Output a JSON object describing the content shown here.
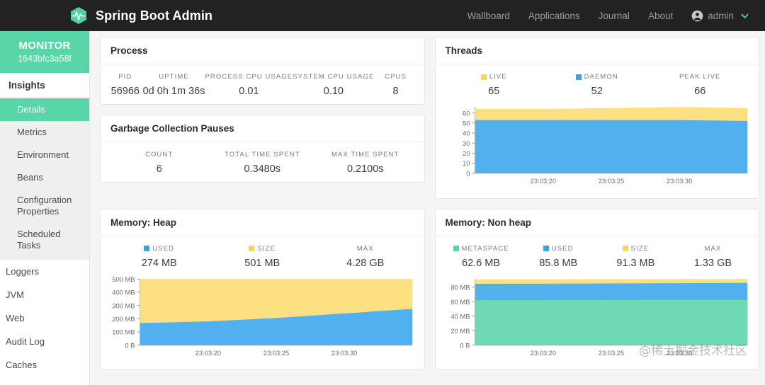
{
  "navbar": {
    "brand": "Spring Boot Admin",
    "logo_icon": "heartbeat-hexagon-icon",
    "links": [
      "Wallboard",
      "Applications",
      "Journal",
      "About"
    ],
    "user": "admin",
    "user_icon": "account-circle-icon",
    "caret_icon": "chevron-down-icon",
    "bg": "#222222",
    "accent": "#58d6a8"
  },
  "sidebar": {
    "app_name": "MONITOR",
    "app_id": "1643bfc3a58f",
    "section": "Insights",
    "insights": [
      {
        "label": "Details",
        "active": true
      },
      {
        "label": "Metrics",
        "active": false
      },
      {
        "label": "Environment",
        "active": false
      },
      {
        "label": "Beans",
        "active": false
      },
      {
        "label": "Configuration Properties",
        "active": false
      },
      {
        "label": "Scheduled Tasks",
        "active": false
      }
    ],
    "roots": [
      "Loggers",
      "JVM",
      "Web",
      "Audit Log",
      "Caches"
    ]
  },
  "process": {
    "title": "Process",
    "stats": [
      {
        "label": "PID",
        "value": "56966"
      },
      {
        "label": "UPTIME",
        "value": "0d 0h 1m 36s"
      },
      {
        "label": "PROCESS CPU USAGE",
        "value": "0.01"
      },
      {
        "label": "SYSTEM CPU USAGE",
        "value": "0.10"
      },
      {
        "label": "CPUS",
        "value": "8"
      }
    ]
  },
  "gc": {
    "title": "Garbage Collection Pauses",
    "stats": [
      {
        "label": "COUNT",
        "value": "6"
      },
      {
        "label": "TOTAL TIME SPENT",
        "value": "0.3480s"
      },
      {
        "label": "MAX TIME SPENT",
        "value": "0.2100s"
      }
    ]
  },
  "threads": {
    "title": "Threads",
    "stats": [
      {
        "label": "LIVE",
        "value": "65",
        "color": "#fbd45e"
      },
      {
        "label": "DAEMON",
        "value": "52",
        "color": "#3ba2e0"
      },
      {
        "label": "PEAK LIVE",
        "value": "66",
        "color": null
      }
    ]
  },
  "heap": {
    "title": "Memory: Heap",
    "stats": [
      {
        "label": "USED",
        "value": "274 MB",
        "color": "#3ba2e0"
      },
      {
        "label": "SIZE",
        "value": "501 MB",
        "color": "#fbd45e"
      },
      {
        "label": "MAX",
        "value": "4.28 GB",
        "color": null
      }
    ]
  },
  "nonheap": {
    "title": "Memory: Non heap",
    "stats": [
      {
        "label": "METASPACE",
        "value": "62.6 MB",
        "color": "#4fd8a8"
      },
      {
        "label": "USED",
        "value": "85.8 MB",
        "color": "#3ba2e0"
      },
      {
        "label": "SIZE",
        "value": "91.3 MB",
        "color": "#fbd45e"
      },
      {
        "label": "MAX",
        "value": "1.33 GB",
        "color": null
      }
    ]
  },
  "watermark": "@稀土掘金技术社区",
  "chart_data": [
    {
      "id": "threads-chart",
      "type": "area",
      "title": "Threads",
      "stacked": true,
      "grid": false,
      "legend_position": "top",
      "x": [
        "23:03:17",
        "23:03:20",
        "23:03:25",
        "23:03:30",
        "23:03:34"
      ],
      "xlabel": "",
      "ylabel": "",
      "xticks": [
        "23:03:20",
        "23:03:25",
        "23:03:30"
      ],
      "yticks": [
        0,
        10,
        20,
        30,
        40,
        50,
        60
      ],
      "ylim": [
        0,
        66
      ],
      "series": [
        {
          "name": "DAEMON",
          "color": "#53b0ee",
          "values": [
            53,
            53,
            53,
            53,
            52
          ]
        },
        {
          "name": "LIVE",
          "color": "#fde082",
          "values": [
            64,
            64,
            65,
            66,
            65
          ]
        }
      ]
    },
    {
      "id": "heap-chart",
      "type": "area",
      "title": "Memory: Heap",
      "stacked": true,
      "grid": false,
      "legend_position": "top",
      "x": [
        "23:03:17",
        "23:03:20",
        "23:03:25",
        "23:03:30",
        "23:03:34"
      ],
      "xlabel": "",
      "ylabel": "",
      "xticks": [
        "23:03:20",
        "23:03:25",
        "23:03:30"
      ],
      "yticks": [
        "0 B",
        "100 MB",
        "200 MB",
        "300 MB",
        "400 MB",
        "500 MB"
      ],
      "ylim": [
        0,
        501
      ],
      "unit": "MB",
      "series": [
        {
          "name": "USED",
          "color": "#53b0ee",
          "values": [
            167,
            180,
            205,
            240,
            274
          ]
        },
        {
          "name": "SIZE",
          "color": "#fde082",
          "values": [
            501,
            501,
            501,
            501,
            501
          ]
        }
      ]
    },
    {
      "id": "nonheap-chart",
      "type": "area",
      "title": "Memory: Non heap",
      "stacked": true,
      "grid": false,
      "legend_position": "top",
      "x": [
        "23:03:17",
        "23:03:20",
        "23:03:25",
        "23:03:30",
        "23:03:34"
      ],
      "xlabel": "",
      "ylabel": "",
      "xticks": [
        "23:03:20",
        "23:03:25",
        "23:03:30"
      ],
      "yticks": [
        "0 B",
        "20 MB",
        "40 MB",
        "60 MB",
        "80 MB"
      ],
      "ylim": [
        0,
        91.3
      ],
      "unit": "MB",
      "series": [
        {
          "name": "METASPACE",
          "color": "#6fd9b6",
          "values": [
            62.0,
            62.1,
            62.3,
            62.5,
            62.6
          ]
        },
        {
          "name": "USED",
          "color": "#53b0ee",
          "values": [
            84.6,
            84.8,
            85.1,
            85.5,
            85.8
          ]
        },
        {
          "name": "SIZE",
          "color": "#fde082",
          "values": [
            90.8,
            90.9,
            91.0,
            91.2,
            91.3
          ]
        }
      ]
    }
  ]
}
